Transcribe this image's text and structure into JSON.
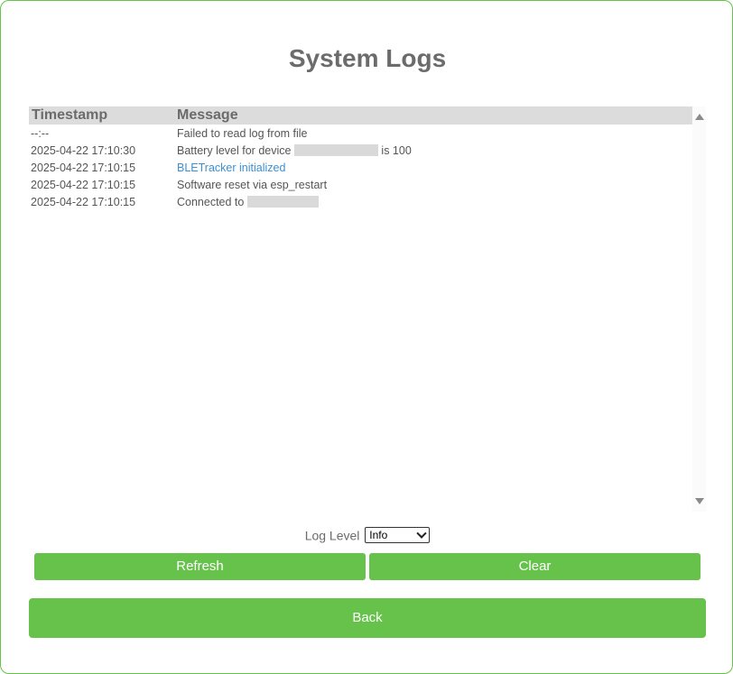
{
  "page": {
    "title": "System Logs"
  },
  "log_table": {
    "columns": [
      "Timestamp",
      "Message"
    ],
    "rows": [
      {
        "timestamp": "--:--",
        "message": "Failed to read log from file",
        "level": "error"
      },
      {
        "timestamp": "2025-04-22 17:10:30",
        "message_prefix": "Battery level for device",
        "message_suffix": "is 100",
        "level": "info",
        "redacted": true
      },
      {
        "timestamp": "2025-04-22 17:10:15",
        "message": "BLETracker initialized",
        "level": "info-highlight"
      },
      {
        "timestamp": "2025-04-22 17:10:15",
        "message": "Software reset via esp_restart",
        "level": "info"
      },
      {
        "timestamp": "2025-04-22 17:10:15",
        "message_prefix": "Connected to",
        "message_suffix": "",
        "level": "info",
        "redacted": true
      }
    ]
  },
  "controls": {
    "log_level_label": "Log Level",
    "log_level_value": "Info",
    "refresh_label": "Refresh",
    "clear_label": "Clear",
    "back_label": "Back"
  },
  "colors": {
    "accent": "#66c24a",
    "header_bg": "#dcdcdc",
    "text": "#6b6b6b",
    "link": "#3d8fd1"
  }
}
